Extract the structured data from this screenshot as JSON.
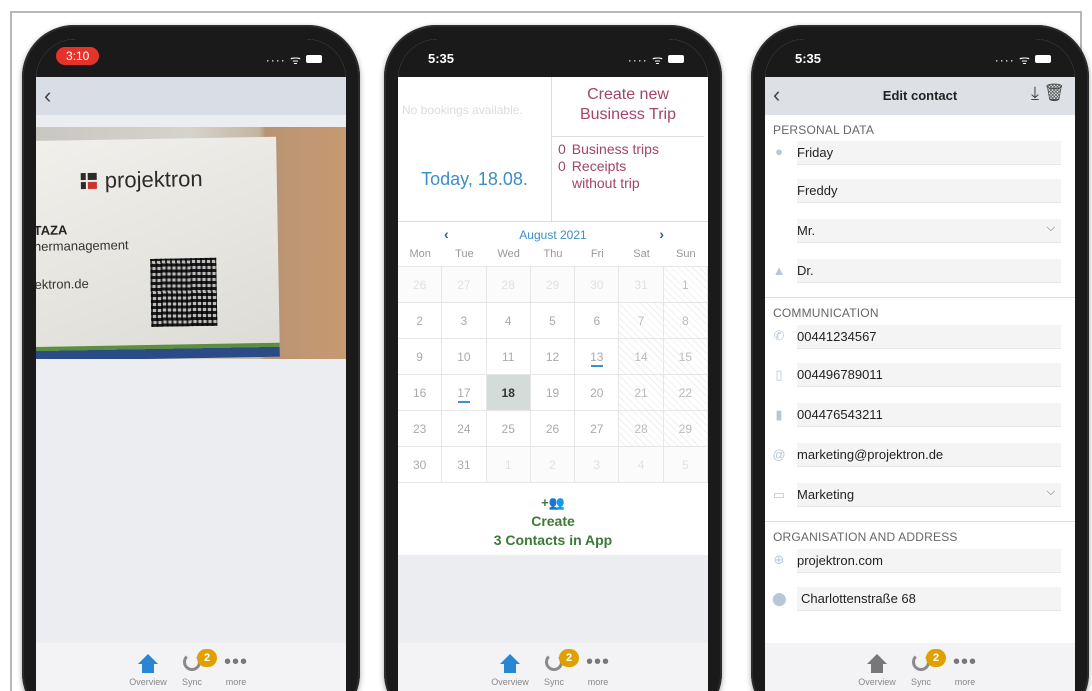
{
  "phones": {
    "scan": {
      "status_time": "3:10",
      "card": {
        "logo": "projektron",
        "name": "TAZA",
        "role": "nermanagement",
        "website": "ektron.de"
      }
    },
    "overview": {
      "status_time": "5:35",
      "no_bookings": "No bookings available.",
      "create_trip": [
        "Create new",
        "Business Trip"
      ],
      "today": "Today, 18.08.",
      "trip_stats": [
        {
          "count": "0",
          "label": "Business trips"
        },
        {
          "count": "0",
          "label": "Receipts"
        },
        {
          "count": "",
          "label": "without trip"
        }
      ],
      "calendar": {
        "month": "August 2021",
        "weekdays": [
          "Mon",
          "Tue",
          "Wed",
          "Thu",
          "Fri",
          "Sat",
          "Sun"
        ],
        "weeks": [
          [
            "26",
            "27",
            "28",
            "29",
            "30",
            "31",
            "1"
          ],
          [
            "2",
            "3",
            "4",
            "5",
            "6",
            "7",
            "8"
          ],
          [
            "9",
            "10",
            "11",
            "12",
            "13",
            "14",
            "15"
          ],
          [
            "16",
            "17",
            "18",
            "19",
            "20",
            "21",
            "22"
          ],
          [
            "23",
            "24",
            "25",
            "26",
            "27",
            "28",
            "29"
          ],
          [
            "30",
            "31",
            "1",
            "2",
            "3",
            "4",
            "5"
          ]
        ],
        "today": "18",
        "marked": [
          "13",
          "17"
        ]
      },
      "create_contacts": [
        "Create",
        "3 Contacts in App"
      ]
    },
    "edit": {
      "status_time": "5:35",
      "title": "Edit contact",
      "sections": {
        "personal": "PERSONAL DATA",
        "communication": "COMMUNICATION",
        "organisation": "ORGANISATION AND ADDRESS"
      },
      "fields": {
        "first_name": "Friday",
        "last_name": "Freddy",
        "salutation": "Mr.",
        "title": "Dr.",
        "phone": "00441234567",
        "mobile": "004496789011",
        "fax": "004476543211",
        "email": "marketing@projektron.de",
        "department": "Marketing",
        "website": "projektron.com",
        "street": "Charlottenstraße 68"
      }
    }
  },
  "tabbar": {
    "overview": "Overview",
    "sync": "Sync",
    "more": "more",
    "sync_badge": "2"
  },
  "colors": {
    "accent_blue": "#3e8ec7",
    "trip_magenta": "#a3446b",
    "contact_green": "#3c7a35",
    "badge": "#e0a100"
  }
}
